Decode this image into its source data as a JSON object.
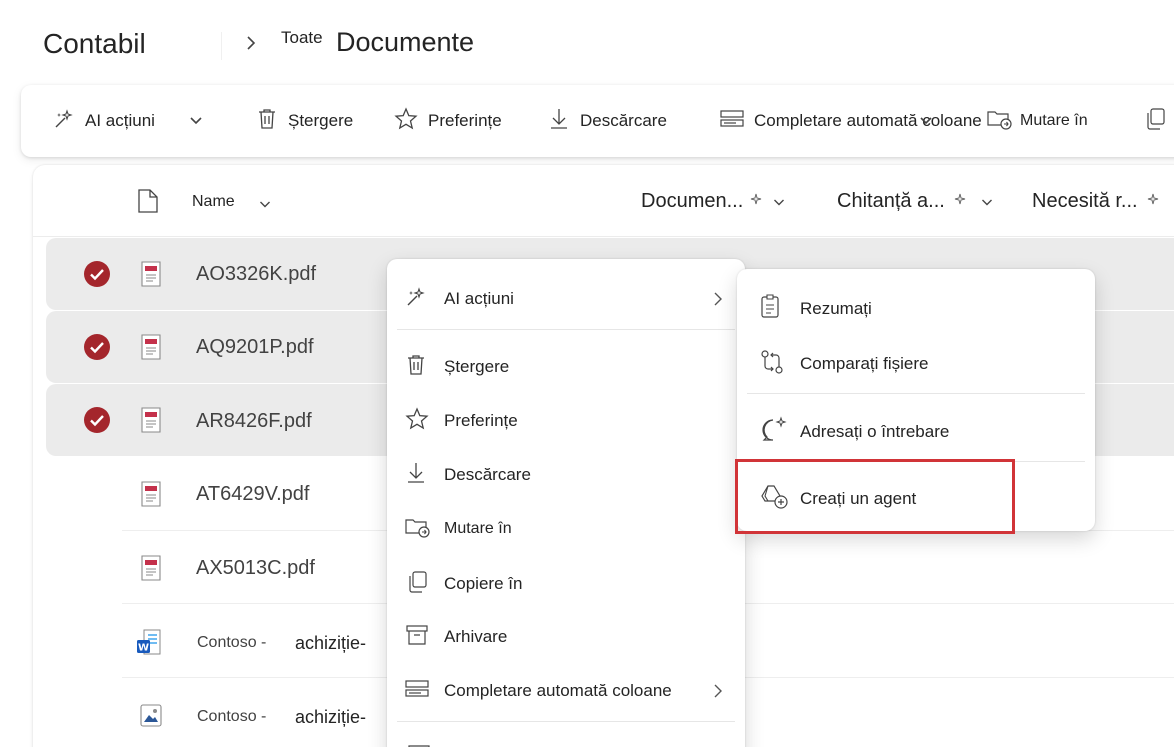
{
  "breadcrumb": {
    "site": "Contabil",
    "separator_icon": "chevron-right-icon",
    "small_label": "Toate",
    "library": "Documente"
  },
  "commandbar": {
    "ai_actions": "AI acțiuni",
    "delete": "Ștergere",
    "favorites": "Preferințe",
    "download": "Descărcare",
    "autofill": "Completare automată coloane",
    "move_to": "Mutare în"
  },
  "list": {
    "header": {
      "name": "Name",
      "columns": [
        "Documen...",
        "Chitanță a...",
        "Necesită r..."
      ]
    },
    "rows": [
      {
        "name": "AO3326K.pdf",
        "selected": true,
        "icon": "pdf-file-icon"
      },
      {
        "name": "AQ9201P.pdf",
        "selected": true,
        "icon": "pdf-file-icon"
      },
      {
        "name": "AR8426F.pdf",
        "selected": true,
        "icon": "pdf-file-icon"
      },
      {
        "name": "AT6429V.pdf",
        "selected": false,
        "icon": "pdf-file-icon"
      },
      {
        "name": "AX5013C.pdf",
        "selected": false,
        "icon": "pdf-file-icon"
      },
      {
        "name": "Contoso -",
        "name_tail": "achiziție-",
        "selected": false,
        "icon": "word-file-icon"
      },
      {
        "name": "Contoso -",
        "name_tail": "achiziție-",
        "selected": false,
        "icon": "image-file-icon"
      }
    ]
  },
  "context_menu": {
    "items": [
      "AI acțiuni",
      "Ștergere",
      "Preferințe",
      "Descărcare",
      "Mutare în",
      "Copiere în",
      "Arhivare",
      "Completare automată coloane"
    ]
  },
  "submenu": {
    "items": [
      "Rezumați",
      "Comparați fișiere",
      "Adresați o întrebare",
      "Creați un agent"
    ]
  },
  "colors": {
    "accent_check": "#a4262c",
    "highlight_box": "#d13438",
    "selected_row": "#ebebeb",
    "pdf_red": "#c4314b",
    "word_blue": "#185abd"
  }
}
